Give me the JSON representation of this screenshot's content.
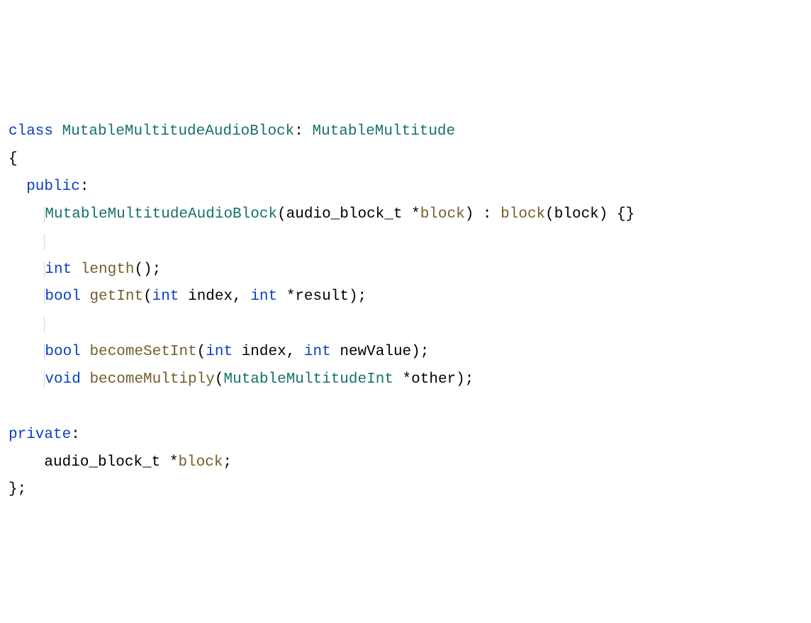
{
  "code": {
    "l1": {
      "kw_class": "class",
      "name": "MutableMultitudeAudioBlock",
      "colon": ": ",
      "base": "MutableMultitude"
    },
    "l2": "{",
    "l3": {
      "kw": "public",
      "colon": ":"
    },
    "l4": {
      "ctor": "MutableMultitudeAudioBlock",
      "sig_a": "(audio_block_t *",
      "param": "block",
      "sig_b": ") : ",
      "init": "block",
      "sig_c": "(block) {}"
    },
    "l5": {
      "ret": "int",
      "fn": "length",
      "rest": "();"
    },
    "l6": {
      "ret": "bool",
      "fn": "getInt",
      "p_open": "(",
      "t1": "int",
      "n1": " index, ",
      "t2": "int",
      "n2": " *result);"
    },
    "l7": {
      "ret": "bool",
      "fn": "becomeSetInt",
      "p_open": "(",
      "t1": "int",
      "n1": " index, ",
      "t2": "int",
      "n2": " newValue);"
    },
    "l8": {
      "ret": "void",
      "fn": "becomeMultiply",
      "p_open": "(",
      "t1": "MutableMultitudeInt",
      "n1": " *other);"
    },
    "l9": {
      "kw": "private",
      "colon": ":"
    },
    "l10": {
      "a": "audio_block_t *",
      "var": "block",
      "b": ";"
    },
    "l11": "};"
  }
}
